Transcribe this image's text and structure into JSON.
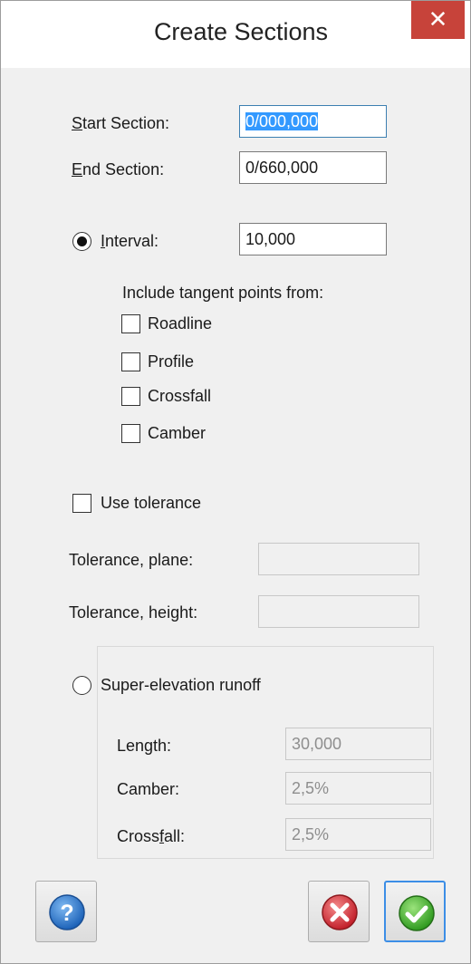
{
  "window": {
    "title": "Create Sections",
    "close_glyph": "✕"
  },
  "start_section": {
    "label_first": "S",
    "label_rest": "tart Section:",
    "value": "0/000,000"
  },
  "end_section": {
    "label_first": "E",
    "label_rest": "nd Section:",
    "value": "0/660,000"
  },
  "interval": {
    "label_first": "I",
    "label_rest": "nterval:",
    "value": "10,000",
    "selected": true
  },
  "tangent": {
    "heading": "Include tangent points from:",
    "options": [
      {
        "label": "Roadline",
        "checked": false
      },
      {
        "label": "Profile",
        "checked": false
      },
      {
        "label": "Crossfall",
        "checked": false
      },
      {
        "label": "Camber",
        "checked": false
      }
    ]
  },
  "tolerance": {
    "use_label": "Use tolerance",
    "use_checked": false,
    "plane_label": "Tolerance, plane:",
    "plane_value": "",
    "height_label": "Tolerance, height:",
    "height_value": ""
  },
  "superelevation": {
    "label": "Super-elevation runoff",
    "selected": false,
    "length_label": "Length:",
    "length_value": "30,000",
    "camber_label": "Camber:",
    "camber_value": "2,5%",
    "crossfall_pre": "Cross",
    "crossfall_ul": "f",
    "crossfall_post": "all:",
    "crossfall_value": "2,5%"
  },
  "buttons": {
    "help_icon": "help-icon",
    "cancel_icon": "cancel-icon",
    "ok_icon": "ok-icon"
  },
  "colors": {
    "close_bg": "#c7433a",
    "selection": "#3399ff",
    "help_blue": "#2c7fd6",
    "cancel_red": "#d9393e",
    "ok_green": "#43b02a"
  }
}
